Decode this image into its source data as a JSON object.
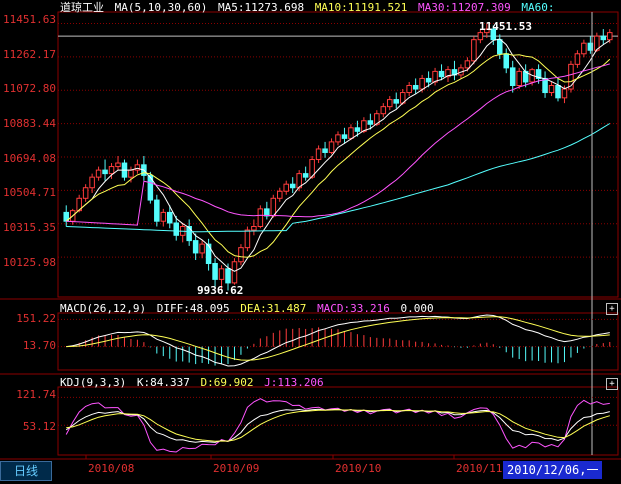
{
  "colors": {
    "bg": "#000000",
    "up": "#ff3c3c",
    "down": "#54fcfc",
    "grid": "#8b0000",
    "ma5": "#ffffff",
    "ma10": "#ffff55",
    "ma30": "#ff55ff",
    "ma60": "#55ffff",
    "axis": "#e03030"
  },
  "main": {
    "title": "道琼工业",
    "indicator": "MA(5,10,30,60)",
    "ma5": "MA5:11273.698",
    "ma10": "MA10:11191.521",
    "ma30": "MA30:11207.309",
    "ma60": "MA60:",
    "yticks": [
      "11451.63",
      "11262.17",
      "11072.80",
      "10883.44",
      "10694.08",
      "10504.71",
      "10315.35",
      "10125.98"
    ],
    "high_label": "11451.53",
    "low_label": "9936.62"
  },
  "macd": {
    "label": "MACD(26,12,9)",
    "diff": "DIFF:48.095",
    "dea": "DEA:31.487",
    "macd": "MACD:33.216",
    "zero": "0.000",
    "yticks": [
      "151.22",
      "13.70"
    ]
  },
  "kdj": {
    "label": "KDJ(9,3,3)",
    "k": "K:84.337",
    "d": "D:69.902",
    "j": "J:113.206",
    "yticks": [
      "121.74",
      "53.12"
    ]
  },
  "bottom": {
    "period": "日线",
    "months": [
      "2010/08",
      "2010/09",
      "2010/10",
      "2010/11"
    ],
    "cursor_date": "2010/12/06,一"
  },
  "candles": [
    {
      "o": 10380,
      "h": 10420,
      "c": 10330,
      "l": 10300
    },
    {
      "o": 10330,
      "h": 10400,
      "c": 10390,
      "l": 10310
    },
    {
      "o": 10390,
      "h": 10480,
      "c": 10460,
      "l": 10380
    },
    {
      "o": 10460,
      "h": 10540,
      "c": 10520,
      "l": 10440
    },
    {
      "o": 10520,
      "h": 10600,
      "c": 10580,
      "l": 10490
    },
    {
      "o": 10580,
      "h": 10640,
      "c": 10620,
      "l": 10560
    },
    {
      "o": 10620,
      "h": 10680,
      "c": 10600,
      "l": 10560
    },
    {
      "o": 10600,
      "h": 10660,
      "c": 10640,
      "l": 10570
    },
    {
      "o": 10640,
      "h": 10700,
      "c": 10660,
      "l": 10620
    },
    {
      "o": 10660,
      "h": 10680,
      "c": 10580,
      "l": 10560
    },
    {
      "o": 10580,
      "h": 10640,
      "c": 10620,
      "l": 10550
    },
    {
      "o": 10620,
      "h": 10680,
      "c": 10650,
      "l": 10600
    },
    {
      "o": 10650,
      "h": 10700,
      "c": 10590,
      "l": 10560
    },
    {
      "o": 10590,
      "h": 10610,
      "c": 10450,
      "l": 10430
    },
    {
      "o": 10450,
      "h": 10480,
      "c": 10330,
      "l": 10300
    },
    {
      "o": 10330,
      "h": 10400,
      "c": 10380,
      "l": 10300
    },
    {
      "o": 10380,
      "h": 10420,
      "c": 10320,
      "l": 10290
    },
    {
      "o": 10320,
      "h": 10360,
      "c": 10250,
      "l": 10220
    },
    {
      "o": 10250,
      "h": 10320,
      "c": 10300,
      "l": 10210
    },
    {
      "o": 10300,
      "h": 10340,
      "c": 10220,
      "l": 10190
    },
    {
      "o": 10220,
      "h": 10260,
      "c": 10150,
      "l": 10110
    },
    {
      "o": 10150,
      "h": 10220,
      "c": 10200,
      "l": 10120
    },
    {
      "o": 10200,
      "h": 10230,
      "c": 10090,
      "l": 10050
    },
    {
      "o": 10090,
      "h": 10120,
      "c": 10000,
      "l": 9960
    },
    {
      "o": 10000,
      "h": 10080,
      "c": 10060,
      "l": 9940
    },
    {
      "o": 10060,
      "h": 10090,
      "c": 9980,
      "l": 9937
    },
    {
      "o": 9980,
      "h": 10120,
      "c": 10100,
      "l": 9970
    },
    {
      "o": 10100,
      "h": 10200,
      "c": 10180,
      "l": 10080
    },
    {
      "o": 10180,
      "h": 10300,
      "c": 10280,
      "l": 10160
    },
    {
      "o": 10280,
      "h": 10340,
      "c": 10300,
      "l": 10250
    },
    {
      "o": 10300,
      "h": 10420,
      "c": 10400,
      "l": 10290
    },
    {
      "o": 10400,
      "h": 10440,
      "c": 10360,
      "l": 10340
    },
    {
      "o": 10360,
      "h": 10480,
      "c": 10460,
      "l": 10350
    },
    {
      "o": 10460,
      "h": 10520,
      "c": 10500,
      "l": 10440
    },
    {
      "o": 10500,
      "h": 10560,
      "c": 10540,
      "l": 10480
    },
    {
      "o": 10540,
      "h": 10580,
      "c": 10520,
      "l": 10490
    },
    {
      "o": 10520,
      "h": 10620,
      "c": 10600,
      "l": 10500
    },
    {
      "o": 10600,
      "h": 10640,
      "c": 10580,
      "l": 10560
    },
    {
      "o": 10580,
      "h": 10700,
      "c": 10680,
      "l": 10570
    },
    {
      "o": 10680,
      "h": 10760,
      "c": 10740,
      "l": 10660
    },
    {
      "o": 10740,
      "h": 10780,
      "c": 10720,
      "l": 10690
    },
    {
      "o": 10720,
      "h": 10800,
      "c": 10780,
      "l": 10710
    },
    {
      "o": 10780,
      "h": 10840,
      "c": 10820,
      "l": 10760
    },
    {
      "o": 10820,
      "h": 10860,
      "c": 10800,
      "l": 10770
    },
    {
      "o": 10800,
      "h": 10880,
      "c": 10860,
      "l": 10790
    },
    {
      "o": 10860,
      "h": 10900,
      "c": 10840,
      "l": 10810
    },
    {
      "o": 10840,
      "h": 10920,
      "c": 10900,
      "l": 10830
    },
    {
      "o": 10900,
      "h": 10940,
      "c": 10880,
      "l": 10850
    },
    {
      "o": 10880,
      "h": 10960,
      "c": 10940,
      "l": 10870
    },
    {
      "o": 10940,
      "h": 11000,
      "c": 10980,
      "l": 10920
    },
    {
      "o": 10980,
      "h": 11040,
      "c": 11020,
      "l": 10960
    },
    {
      "o": 11020,
      "h": 11060,
      "c": 11000,
      "l": 10970
    },
    {
      "o": 11000,
      "h": 11080,
      "c": 11060,
      "l": 10990
    },
    {
      "o": 11060,
      "h": 11120,
      "c": 11100,
      "l": 11040
    },
    {
      "o": 11100,
      "h": 11140,
      "c": 11080,
      "l": 11050
    },
    {
      "o": 11080,
      "h": 11160,
      "c": 11140,
      "l": 11060
    },
    {
      "o": 11140,
      "h": 11180,
      "c": 11120,
      "l": 11090
    },
    {
      "o": 11120,
      "h": 11200,
      "c": 11180,
      "l": 11100
    },
    {
      "o": 11180,
      "h": 11220,
      "c": 11150,
      "l": 11130
    },
    {
      "o": 11150,
      "h": 11210,
      "c": 11190,
      "l": 11120
    },
    {
      "o": 11190,
      "h": 11240,
      "c": 11160,
      "l": 11130
    },
    {
      "o": 11160,
      "h": 11220,
      "c": 11200,
      "l": 11140
    },
    {
      "o": 11200,
      "h": 11260,
      "c": 11240,
      "l": 11180
    },
    {
      "o": 11240,
      "h": 11380,
      "c": 11360,
      "l": 11220
    },
    {
      "o": 11360,
      "h": 11420,
      "c": 11400,
      "l": 11340
    },
    {
      "o": 11400,
      "h": 11452,
      "c": 11420,
      "l": 11370
    },
    {
      "o": 11420,
      "h": 11440,
      "c": 11360,
      "l": 11330
    },
    {
      "o": 11360,
      "h": 11390,
      "c": 11280,
      "l": 11250
    },
    {
      "o": 11280,
      "h": 11310,
      "c": 11200,
      "l": 11170
    },
    {
      "o": 11200,
      "h": 11240,
      "c": 11100,
      "l": 11060
    },
    {
      "o": 11100,
      "h": 11200,
      "c": 11180,
      "l": 11080
    },
    {
      "o": 11180,
      "h": 11220,
      "c": 11120,
      "l": 11090
    },
    {
      "o": 11120,
      "h": 11200,
      "c": 11190,
      "l": 11100
    },
    {
      "o": 11190,
      "h": 11220,
      "c": 11140,
      "l": 11110
    },
    {
      "o": 11140,
      "h": 11180,
      "c": 11060,
      "l": 11030
    },
    {
      "o": 11060,
      "h": 11120,
      "c": 11100,
      "l": 11040
    },
    {
      "o": 11100,
      "h": 11140,
      "c": 11030,
      "l": 11010
    },
    {
      "o": 11030,
      "h": 11100,
      "c": 11080,
      "l": 11000
    },
    {
      "o": 11080,
      "h": 11240,
      "c": 11220,
      "l": 11060
    },
    {
      "o": 11220,
      "h": 11300,
      "c": 11280,
      "l": 11200
    },
    {
      "o": 11280,
      "h": 11360,
      "c": 11340,
      "l": 11260
    },
    {
      "o": 11340,
      "h": 11380,
      "c": 11300,
      "l": 11280
    },
    {
      "o": 11300,
      "h": 11400,
      "c": 11380,
      "l": 11290
    },
    {
      "o": 11380,
      "h": 11420,
      "c": 11360,
      "l": 11330
    },
    {
      "o": 11360,
      "h": 11420,
      "c": 11400,
      "l": 11340
    }
  ]
}
